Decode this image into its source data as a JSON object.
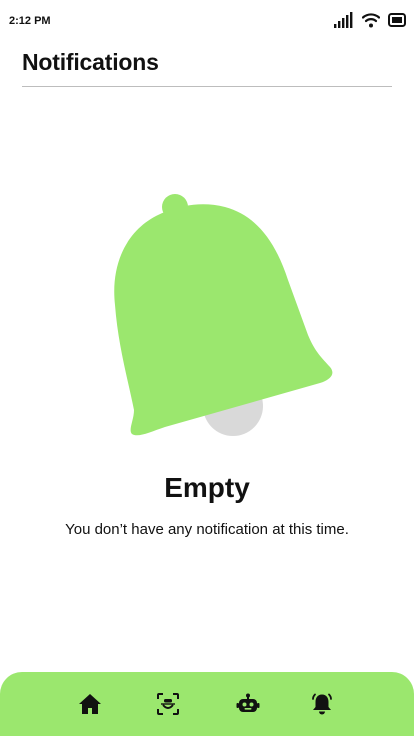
{
  "status_bar": {
    "time": "2:12 PM",
    "icons": [
      "signal-icon",
      "wifi-icon",
      "battery-icon"
    ]
  },
  "header": {
    "title": "Notifications"
  },
  "empty_state": {
    "illustration": "bell-icon",
    "title": "Empty",
    "message": "You don’t have any notification at this time."
  },
  "bottom_nav": {
    "items": [
      {
        "icon": "home-icon"
      },
      {
        "icon": "face-scan-icon"
      },
      {
        "icon": "robot-icon"
      },
      {
        "icon": "bell-icon",
        "active": true
      }
    ]
  },
  "colors": {
    "accent": "#9be76e",
    "bell_clapper": "#d9d9d9",
    "divider": "#bdbdbd",
    "text": "#111111",
    "background": "#ffffff"
  }
}
